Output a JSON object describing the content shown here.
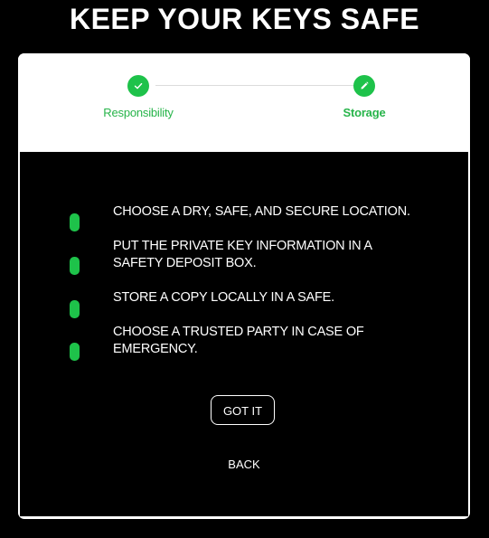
{
  "page": {
    "title": "KEEP YOUR KEYS SAFE"
  },
  "stepper": {
    "steps": [
      {
        "label": "Responsibility",
        "icon": "check-icon",
        "state": "completed"
      },
      {
        "label": "Storage",
        "icon": "pencil-icon",
        "state": "active"
      }
    ]
  },
  "tips": [
    {
      "text": "CHOOSE A DRY, SAFE, AND SECURE LOCATION."
    },
    {
      "text": "PUT THE PRIVATE KEY INFORMATION IN A SAFETY DEPOSIT BOX."
    },
    {
      "text": "STORE A COPY LOCALLY IN A SAFE."
    },
    {
      "text": "CHOOSE A TRUSTED PARTY IN CASE OF EMERGENCY."
    }
  ],
  "actions": {
    "got_it_label": "GOT IT",
    "back_label": "BACK"
  },
  "colors": {
    "accent": "#1ec24a",
    "background": "#000000",
    "card": "#ffffff"
  }
}
